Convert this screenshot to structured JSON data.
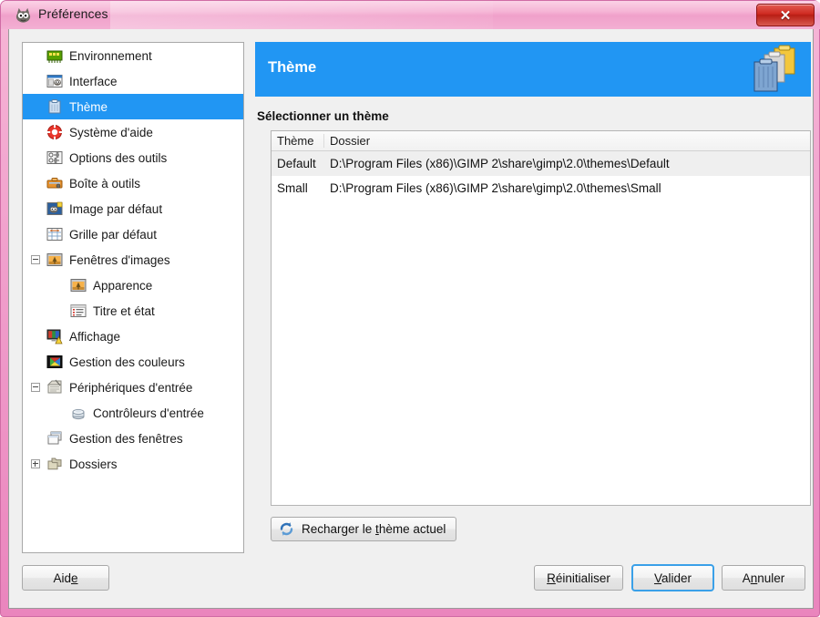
{
  "window": {
    "title": "Préférences",
    "app_icon": "wilber-gimp-icon",
    "close_label": "✕",
    "accent_blue": "#2196f3",
    "titlebar_pink": "#f2a8cf",
    "close_red": "#cf2a21"
  },
  "sidebar": {
    "items": [
      {
        "label": "Environnement",
        "icon": "environment-icon",
        "indent": 0,
        "expander": "none",
        "selected": false
      },
      {
        "label": "Interface",
        "icon": "interface-icon",
        "indent": 0,
        "expander": "none",
        "selected": false
      },
      {
        "label": "Thème",
        "icon": "theme-icon",
        "indent": 0,
        "expander": "none",
        "selected": true
      },
      {
        "label": "Système d'aide",
        "icon": "help-system-icon",
        "indent": 0,
        "expander": "none",
        "selected": false
      },
      {
        "label": "Options des outils",
        "icon": "tool-options-icon",
        "indent": 0,
        "expander": "none",
        "selected": false
      },
      {
        "label": "Boîte à outils",
        "icon": "toolbox-icon",
        "indent": 0,
        "expander": "none",
        "selected": false
      },
      {
        "label": "Image par défaut",
        "icon": "default-image-icon",
        "indent": 0,
        "expander": "none",
        "selected": false
      },
      {
        "label": "Grille par défaut",
        "icon": "default-grid-icon",
        "indent": 0,
        "expander": "none",
        "selected": false
      },
      {
        "label": "Fenêtres d'images",
        "icon": "image-windows-icon",
        "indent": 0,
        "expander": "expanded",
        "selected": false
      },
      {
        "label": "Apparence",
        "icon": "appearance-icon",
        "indent": 1,
        "expander": "none",
        "selected": false
      },
      {
        "label": "Titre et état",
        "icon": "title-status-icon",
        "indent": 1,
        "expander": "none",
        "selected": false
      },
      {
        "label": "Affichage",
        "icon": "display-icon",
        "indent": 0,
        "expander": "none",
        "selected": false
      },
      {
        "label": "Gestion des couleurs",
        "icon": "color-management-icon",
        "indent": 0,
        "expander": "none",
        "selected": false
      },
      {
        "label": "Périphériques d'entrée",
        "icon": "input-devices-icon",
        "indent": 0,
        "expander": "expanded",
        "selected": false
      },
      {
        "label": "Contrôleurs d'entrée",
        "icon": "input-controllers-icon",
        "indent": 1,
        "expander": "none",
        "selected": false
      },
      {
        "label": "Gestion des fenêtres",
        "icon": "window-management-icon",
        "indent": 0,
        "expander": "none",
        "selected": false
      },
      {
        "label": "Dossiers",
        "icon": "folders-icon",
        "indent": 0,
        "expander": "collapsed",
        "selected": false
      }
    ]
  },
  "content": {
    "banner_title": "Thème",
    "banner_icon": "theme-stack-icon",
    "section_label": "Sélectionner un thème",
    "table": {
      "columns": [
        "Thème",
        "Dossier"
      ],
      "rows": [
        {
          "theme": "Default",
          "folder": "D:\\Program Files (x86)\\GIMP 2\\share\\gimp\\2.0\\themes\\Default",
          "selected": true
        },
        {
          "theme": "Small",
          "folder": "D:\\Program Files (x86)\\GIMP 2\\share\\gimp\\2.0\\themes\\Small",
          "selected": false
        }
      ]
    },
    "reload_button": {
      "text_before": "Recharger le ",
      "mnemonic": "t",
      "text_after": "hème actuel",
      "icon": "refresh-icon"
    }
  },
  "footer": {
    "help": {
      "text_before": "Aid",
      "mnemonic": "e",
      "text_after": ""
    },
    "reset": {
      "text_before": "",
      "mnemonic": "R",
      "text_after": "éinitialiser"
    },
    "ok": {
      "text_before": "",
      "mnemonic": "V",
      "text_after": "alider",
      "focused": true
    },
    "cancel": {
      "text_before": "A",
      "mnemonic": "n",
      "text_after": "nuler"
    }
  }
}
